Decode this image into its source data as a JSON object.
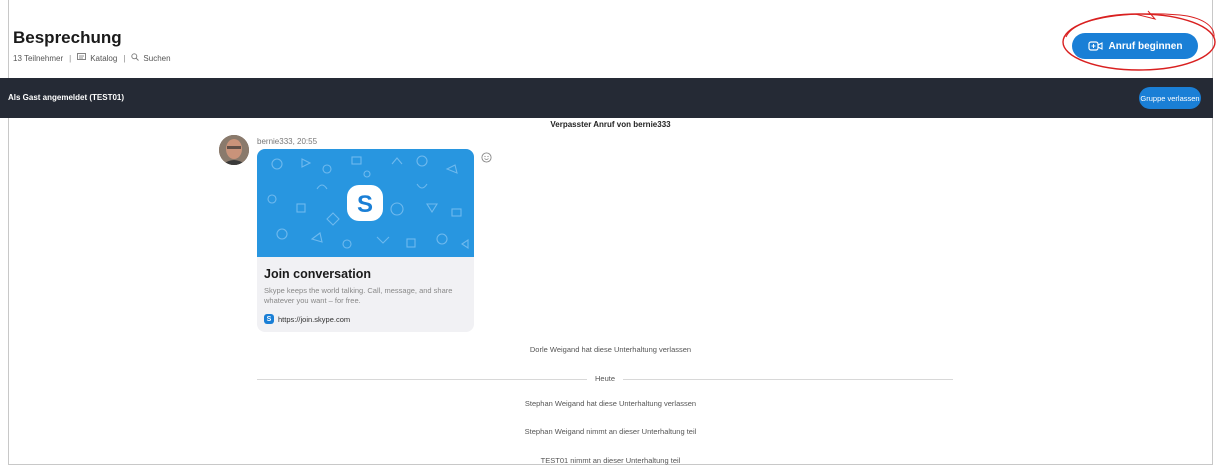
{
  "header": {
    "title": "Besprechung",
    "participants": "13 Teilnehmer",
    "catalog": "Katalog",
    "search": "Suchen",
    "call_button": "Anruf beginnen"
  },
  "guest_bar": {
    "status": "Als Gast angemeldet (TEST01)",
    "leave_button": "Gruppe verlassen"
  },
  "chat": {
    "missed_call": "Verpasster Anruf von bernie333",
    "message": {
      "sender": "bernie333, 20:55",
      "card": {
        "title": "Join conversation",
        "description": "Skype keeps the world talking. Call, message, and share whatever you want – for free.",
        "link": "https://join.skype.com"
      }
    },
    "system_messages": [
      "Dorle Weigand hat diese Unterhaltung verlassen",
      "Stephan Weigand hat diese Unterhaltung verlassen",
      "Stephan Weigand nimmt an dieser Unterhaltung teil",
      "TEST01 nimmt an dieser Unterhaltung teil"
    ],
    "date_divider": "Heute"
  },
  "colors": {
    "accent": "#1a7fd6",
    "guest_bar": "#252a35",
    "annotation": "#d92020"
  }
}
